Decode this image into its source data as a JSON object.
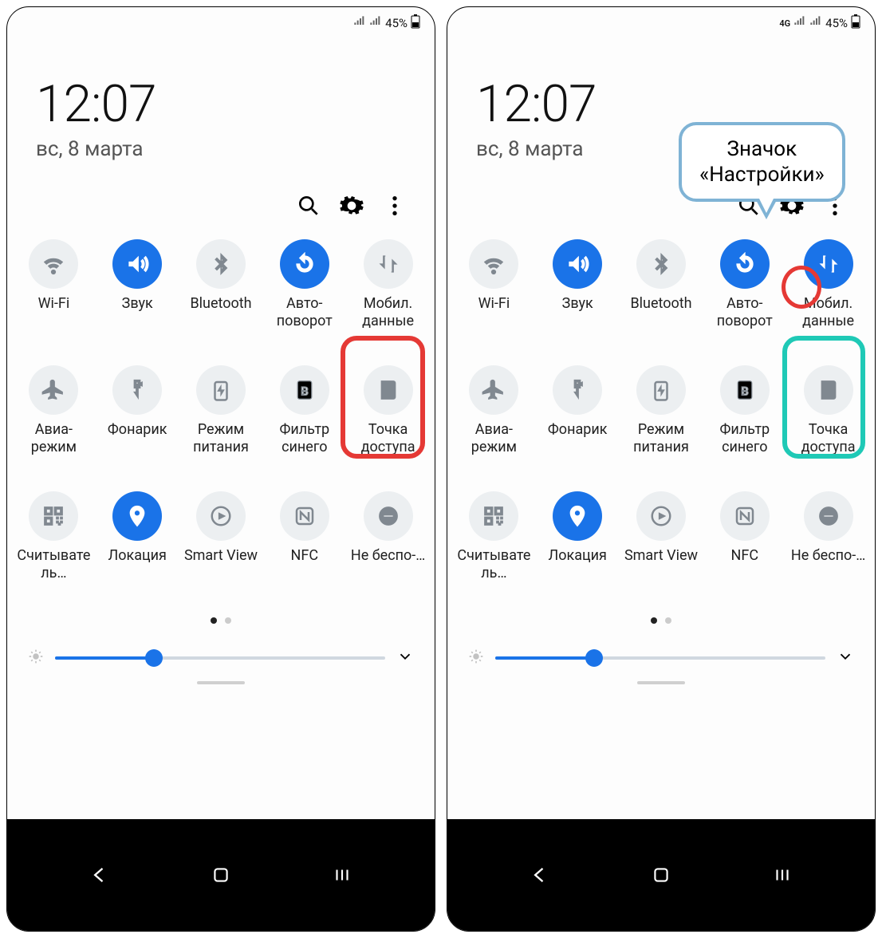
{
  "status": {
    "battery_pct": "45%",
    "network_4g": "4G"
  },
  "header": {
    "time": "12:07",
    "date": "вс, 8 марта"
  },
  "tiles": [
    {
      "id": "wifi",
      "label": "Wi-Fi"
    },
    {
      "id": "sound",
      "label": "Звук"
    },
    {
      "id": "bluetooth",
      "label": "Bluetooth"
    },
    {
      "id": "rotate",
      "label": "Авто-поворот"
    },
    {
      "id": "mobiledata",
      "label": "Мобил. данные"
    },
    {
      "id": "airplane",
      "label": "Авиа-режим"
    },
    {
      "id": "flashlight",
      "label": "Фонарик"
    },
    {
      "id": "power",
      "label": "Режим питания"
    },
    {
      "id": "bluefilter",
      "label": "Фильтр синего"
    },
    {
      "id": "hotspot",
      "label": "Точка доступа"
    },
    {
      "id": "qr",
      "label": "Считыватель…"
    },
    {
      "id": "location",
      "label": "Локация"
    },
    {
      "id": "smartview",
      "label": "Smart View"
    },
    {
      "id": "nfc",
      "label": "NFC"
    },
    {
      "id": "dnd",
      "label": "Не беспо-…"
    }
  ],
  "panel_left": {
    "active": [
      "sound",
      "rotate",
      "location"
    ]
  },
  "panel_right": {
    "active": [
      "sound",
      "rotate",
      "mobiledata",
      "location"
    ],
    "show_4g": true
  },
  "callout": {
    "line1": "Значок",
    "line2": "«Настройки»"
  },
  "highlights": {
    "left_mobile_ring": "red",
    "right_mobile_ring": "teal",
    "right_gear_ring": "red"
  },
  "brightness": {
    "percent": 30
  }
}
